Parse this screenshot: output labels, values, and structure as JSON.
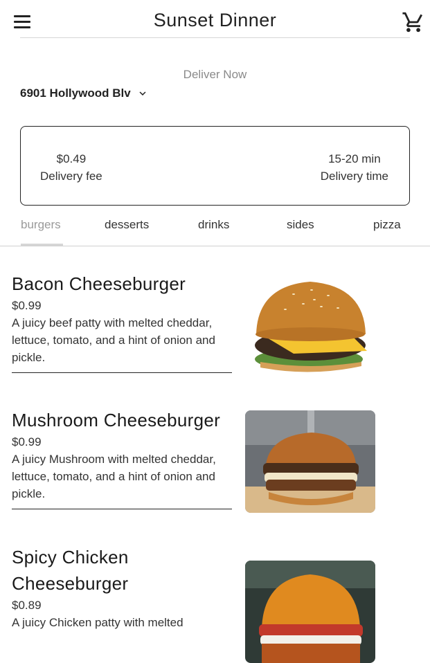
{
  "header": {
    "title": "Sunset Dinner",
    "menu_icon": "hamburger-menu-icon",
    "cart_icon": "shopping-cart-icon"
  },
  "delivery": {
    "mode_label": "Deliver Now",
    "address": "6901 Hollywood Blv",
    "fee_value": "$0.49",
    "fee_label": "Delivery fee",
    "time_value": "15-20 min",
    "time_label": "Delivery time"
  },
  "tabs": [
    {
      "label": "burgers",
      "active": true
    },
    {
      "label": "desserts",
      "active": false
    },
    {
      "label": "drinks",
      "active": false
    },
    {
      "label": "sides",
      "active": false
    },
    {
      "label": "pizza",
      "active": false
    }
  ],
  "menu_items": [
    {
      "name": "Bacon Cheeseburger",
      "price": "$0.99",
      "description": "A juicy beef patty with melted cheddar, lettuce, tomato, and a hint of onion and pickle.",
      "image": "cheeseburger-photo"
    },
    {
      "name": "Mushroom Cheeseburger",
      "price": "$0.99",
      "description": "A juicy Mushroom with melted cheddar, lettuce, tomato, and a hint of onion and pickle.",
      "image": "mushroom-burger-photo"
    },
    {
      "name": "Spicy Chicken Cheeseburger",
      "price": "$0.89",
      "description": "A juicy Chicken patty with melted",
      "image": "chicken-burger-photo"
    }
  ],
  "colors": {
    "text": "#1f1f1f",
    "muted": "#8a8a8a",
    "active_tab": "#9a9a9a",
    "indicator": "#d6d6d6"
  }
}
